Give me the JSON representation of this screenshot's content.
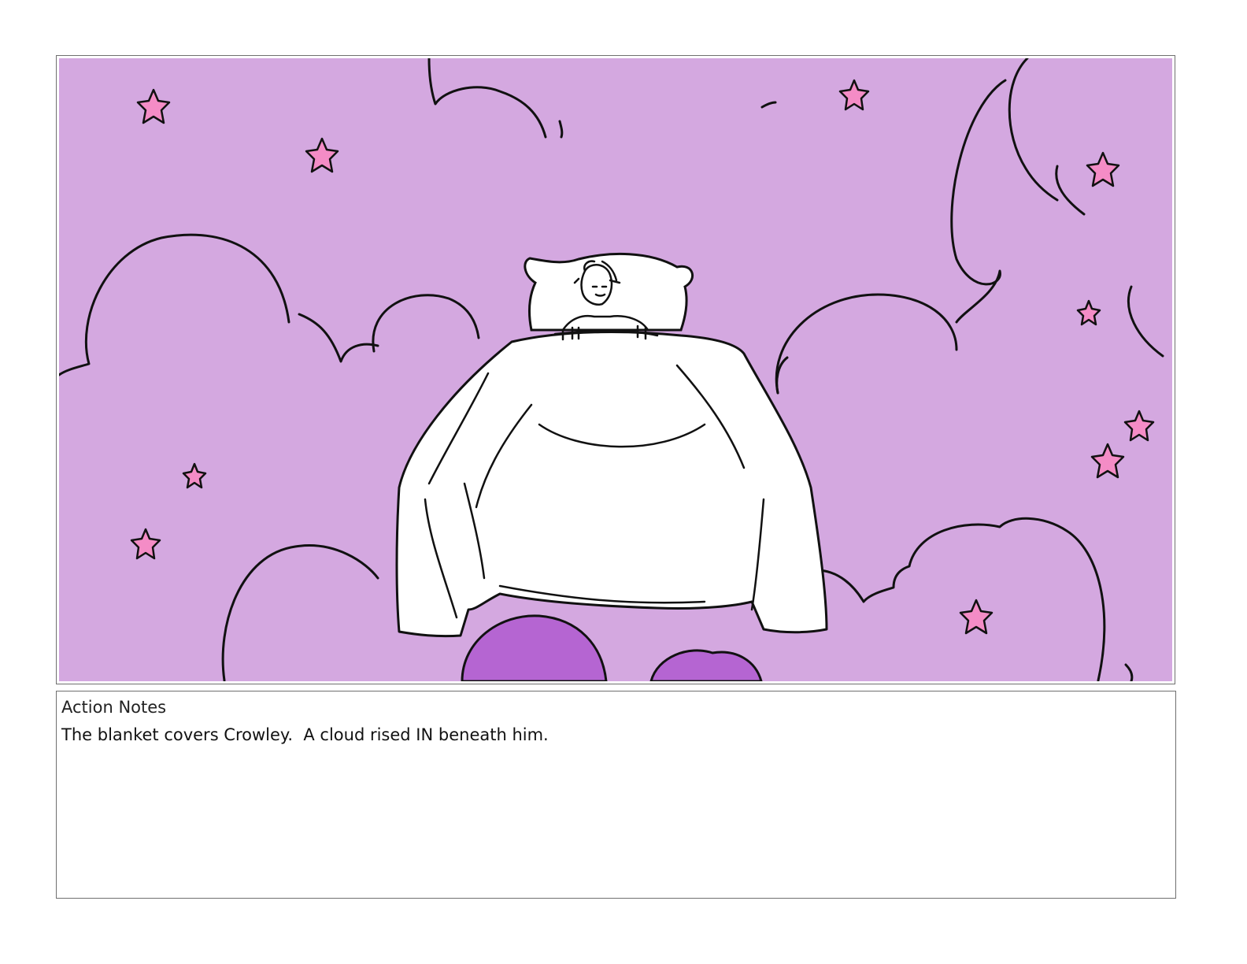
{
  "storyboard_panel": {
    "colors": {
      "sky": "#d4a8e0",
      "star_fill": "#f48cc6",
      "cloud_fill": "#b565d2",
      "ink": "#111111",
      "blanket": "#ffffff"
    },
    "icon": "storyboard-illustration"
  },
  "action_notes": {
    "heading": "Action Notes",
    "text": "The blanket covers Crowley.  A cloud rised IN beneath him."
  }
}
